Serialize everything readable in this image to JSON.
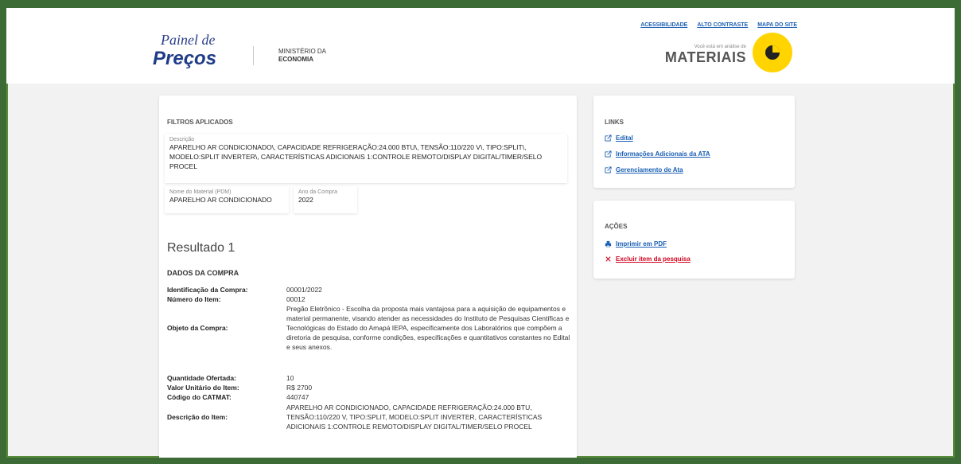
{
  "header": {
    "links": [
      "ACESSIBILIDADE",
      "ALTO CONTRASTE",
      "MAPA DO SITE"
    ],
    "logo_line1": "Painel de",
    "logo_line2": "Preços",
    "ministry_line1": "MINISTÉRIO DA",
    "ministry_line2": "ECONOMIA",
    "analysis_small": "Você está em análise de",
    "analysis_big": "MATERIAIS",
    "colors": {
      "accent_yellow": "#ffd400",
      "link_blue": "#1a5fb4"
    }
  },
  "filters": {
    "title": "FILTROS APLICADOS",
    "descricao_label": "Descrição",
    "descricao_value": "APARELHO AR CONDICIONADO\\, CAPACIDADE REFRIGERAÇÃO:24.000 BTU\\, TENSÃO:110/220 V\\, TIPO:SPLIT\\, MODELO:SPLIT INVERTER\\, CARACTERÍSTICAS ADICIONAIS 1:CONTROLE REMOTO/DISPLAY DIGITAL/TIMER/SELO PROCEL",
    "nome_label": "Nome do Material (PDM)",
    "nome_value": "APARELHO AR CONDICIONADO",
    "ano_label": "Ano da Compra",
    "ano_value": "2022"
  },
  "result": {
    "title": "Resultado 1",
    "section": "DADOS DA COMPRA",
    "fields": [
      {
        "key": "Identificação da Compra:",
        "value": "00001/2022"
      },
      {
        "key": "Número do Item:",
        "value": "00012"
      },
      {
        "key": "Objeto da Compra:",
        "value": "Pregão Eletrônico - Escolha da proposta mais vantajosa para a aquisição de equipamentos e material permanente, visando atender as necessidades do Instituto de Pesquisas Científicas e Tecnológicas do Estado do Amapá IEPA, especificamente dos Laboratórios que compõem a diretoria de pesquisa, conforme condições, especificações e quantitativos constantes no Edital e seus anexos."
      },
      {
        "key": "Quantidade Ofertada:",
        "value": "10"
      },
      {
        "key": "Valor Unitário do Item:",
        "value": "R$ 2700"
      },
      {
        "key": "Código do CATMAT:",
        "value": "440747"
      },
      {
        "key": "Descrição do Item:",
        "value": "APARELHO AR CONDICIONADO, CAPACIDADE REFRIGERAÇÃO:24.000 BTU, TENSÃO:110/220 V, TIPO:SPLIT, MODELO:SPLIT INVERTER, CARACTERÍSTICAS ADICIONAIS 1:CONTROLE REMOTO/DISPLAY DIGITAL/TIMER/SELO PROCEL"
      }
    ]
  },
  "links": {
    "title": "LINKS",
    "items": [
      "Edital",
      "Informações Adicionais da ATA",
      "Gerenciamento de Ata"
    ]
  },
  "acoes": {
    "title": "AÇÕES",
    "print": "Imprimir em PDF",
    "exclude": "Excluir item da pesquisa"
  }
}
